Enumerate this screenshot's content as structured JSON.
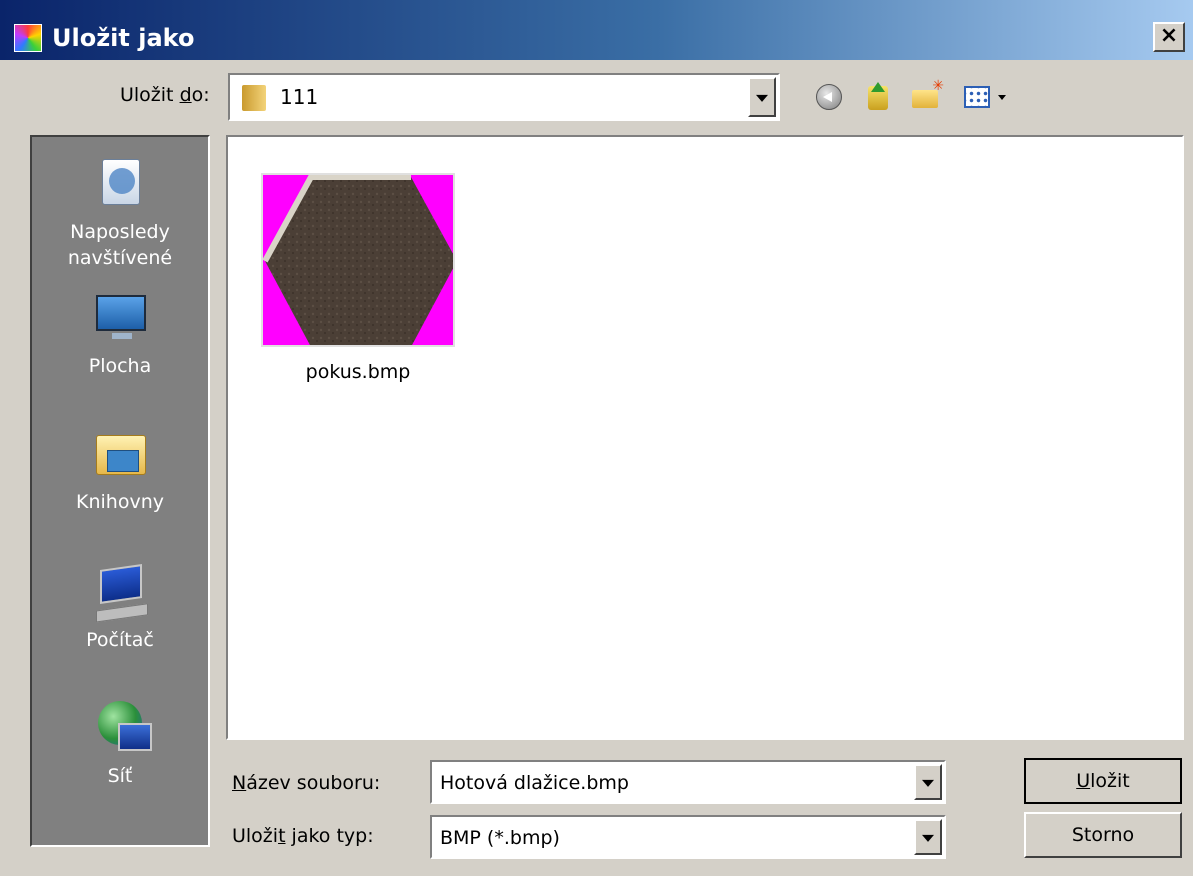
{
  "window": {
    "title": "Uložit jako",
    "close_label": "×"
  },
  "save_in": {
    "label_pre": "Uložit ",
    "label_key": "d",
    "label_post": "o:",
    "value": "111"
  },
  "toolbar": {
    "icons": [
      "back-icon",
      "up-folder-icon",
      "new-folder-icon",
      "view-menu-icon"
    ]
  },
  "places": [
    {
      "id": "recent",
      "label_line1": "Naposledy",
      "label_line2": "navštívené",
      "icon": "recent-places-icon"
    },
    {
      "id": "desktop",
      "label_line1": "Plocha",
      "icon": "desktop-icon"
    },
    {
      "id": "libraries",
      "label_line1": "Knihovny",
      "icon": "libraries-icon"
    },
    {
      "id": "computer",
      "label_line1": "Počítač",
      "icon": "computer-icon"
    },
    {
      "id": "network",
      "label_line1": "Síť",
      "icon": "network-icon"
    }
  ],
  "files": [
    {
      "name": "pokus.bmp",
      "thumbnail": "hexagon-tile"
    }
  ],
  "filename": {
    "label_key": "N",
    "label_rest": "ázev souboru:",
    "value": "Hotová dlažice.bmp"
  },
  "filetype": {
    "label_pre": "Uloži",
    "label_key": "t",
    "label_post": " jako typ:",
    "value": "BMP (*.bmp)"
  },
  "buttons": {
    "save_key": "U",
    "save_rest": "ložit",
    "cancel": "Storno"
  },
  "colors": {
    "title_gradient_start": "#0a246a",
    "title_gradient_end": "#a6caf0",
    "places_bg": "#808080",
    "thumb_bg": "#ff00ff"
  }
}
